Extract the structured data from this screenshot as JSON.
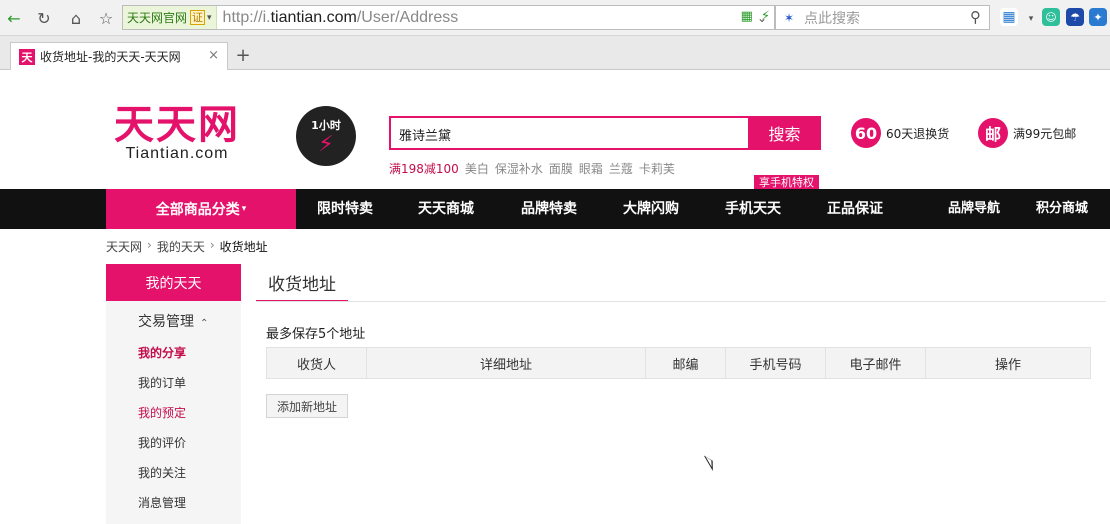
{
  "browser": {
    "site_name": "天天网官网",
    "cert_label": "证",
    "url_prefix": "http://i.",
    "url_domain": "tiantian.com",
    "url_path": "/User/Address",
    "search_placeholder": "点此搜索",
    "tab_favicon": "天",
    "tab_title": "收货地址-我的天天-天天网",
    "tab_close": "×",
    "new_tab": "+"
  },
  "header": {
    "logo_cn": "天天网",
    "logo_en": "Tiantian.com",
    "onehour_label": "1小时",
    "search_value": "雅诗兰黛",
    "search_button": "搜索",
    "hot_keywords": [
      "满198减100",
      "美白",
      "保湿补水",
      "面膜",
      "眼霜",
      "兰蔻",
      "卡莉芙"
    ],
    "services": [
      {
        "badge": "60",
        "text": "60天退换货"
      },
      {
        "badge": "邮",
        "text": "满99元包邮"
      }
    ]
  },
  "nav": {
    "all_categories": "全部商品分类",
    "items": [
      "限时特卖",
      "天天商城",
      "品牌特卖",
      "大牌闪购",
      "手机天天",
      "正品保证",
      "品牌导航",
      "积分商城"
    ],
    "tip": "享手机特权"
  },
  "breadcrumb": [
    "天天网",
    "我的天天",
    "收货地址"
  ],
  "sidebar": {
    "header": "我的天天",
    "group": "交易管理",
    "links": [
      "我的分享",
      "我的订单",
      "我的预定",
      "我的评价",
      "我的关注",
      "消息管理"
    ]
  },
  "main": {
    "title": "收货地址",
    "limit_text": "最多保存5个地址",
    "columns": [
      "收货人",
      "详细地址",
      "邮编",
      "手机号码",
      "电子邮件",
      "操作"
    ],
    "add_button": "添加新地址"
  },
  "colors": {
    "accent": "#e4126b",
    "navbar": "#111111"
  }
}
